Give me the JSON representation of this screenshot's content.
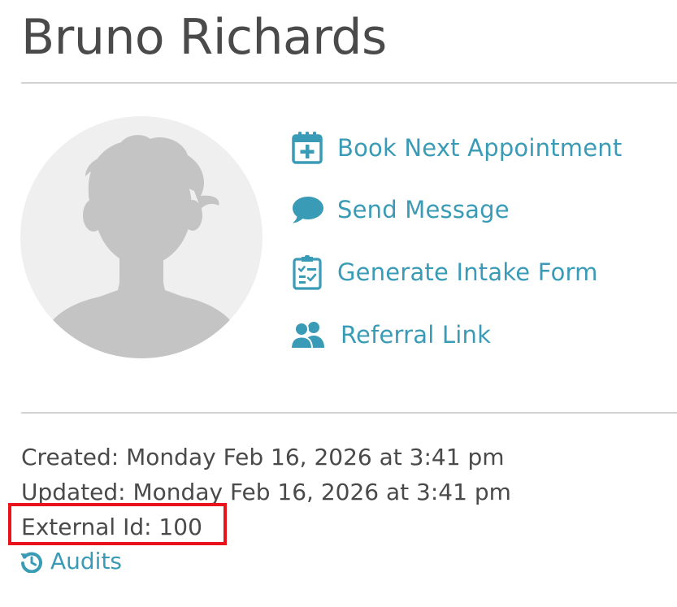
{
  "client": {
    "name": "Bruno Richards"
  },
  "actions": [
    {
      "label": "Book Next Appointment",
      "icon": "calendar-plus-icon"
    },
    {
      "label": "Send Message",
      "icon": "chat-bubble-icon"
    },
    {
      "label": "Generate Intake Form",
      "icon": "clipboard-checklist-icon"
    },
    {
      "label": "Referral Link",
      "icon": "users-icon"
    }
  ],
  "meta": {
    "created": "Created: Monday Feb 16, 2026 at 3:41 pm",
    "updated": "Updated: Monday Feb 16, 2026 at 3:41 pm",
    "external_id": "External Id: 100"
  },
  "audits": {
    "label": "Audits",
    "icon": "history-icon"
  },
  "colors": {
    "accent": "#3a9bb6",
    "text": "#4a4a4a",
    "divider": "#d3d3d3",
    "highlight": "#e8131b",
    "avatar_bg": "#efefef",
    "avatar_silhouette": "#c4c4c4"
  }
}
